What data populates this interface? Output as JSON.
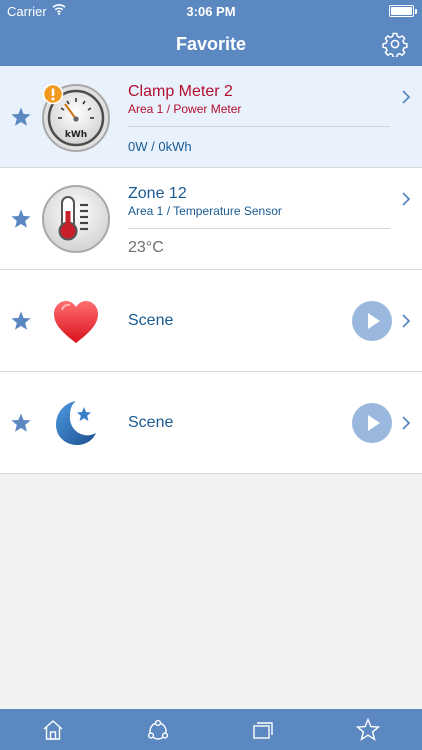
{
  "status_bar": {
    "carrier": "Carrier",
    "time": "3:06 PM",
    "wifi_icon": "wifi-icon",
    "battery_icon": "battery-icon"
  },
  "nav": {
    "title": "Favorite",
    "settings_icon": "gear-icon"
  },
  "colors": {
    "bar": "#5b88c1",
    "alert_text": "#b3102e",
    "link_text": "#1a5a92",
    "highlight_row": "#e9f2fc",
    "play_button": "#9ab7dd"
  },
  "devices": [
    {
      "name": "Clamp Meter 2",
      "location": "Area 1 / Power Meter",
      "reading": "0W / 0kWh",
      "icon": "power-meter-icon",
      "alert": true,
      "favorite": true
    },
    {
      "name": "Zone 12",
      "location": "Area 1 / Temperature Sensor",
      "reading": "23°C",
      "icon": "thermometer-icon",
      "alert": false,
      "favorite": true
    }
  ],
  "scenes": [
    {
      "name": "Scene",
      "icon": "heart-icon",
      "favorite": true
    },
    {
      "name": "Scene",
      "icon": "moon-star-icon",
      "favorite": true
    }
  ],
  "tab_bar": [
    "home-icon",
    "scene-cycle-icon",
    "rooms-icon",
    "favorite-star-icon"
  ]
}
